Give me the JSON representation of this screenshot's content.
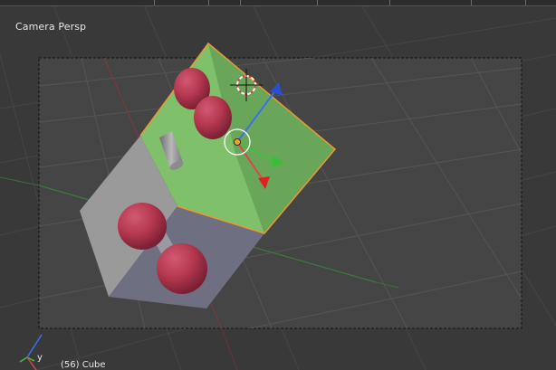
{
  "viewport": {
    "view_label": "Camera Persp",
    "object_label": "(56) Cube"
  },
  "axis_gizmo": {
    "y_label": "y",
    "x_color": "#d94646",
    "y_color": "#3ec13e",
    "z_color": "#3c6ef0"
  },
  "colors": {
    "background": "#393939",
    "camera_frame_fill": "#434343",
    "selected_face": "#7fc06a",
    "selection_outline": "#e89a33",
    "sphere": "#b4374f",
    "grid": "#4a4a4a",
    "x_axis_line": "#7a3a3a",
    "y_axis_line": "#3d7a3d"
  },
  "icons": [
    "3d-cursor-icon",
    "translate-gizmo-icon",
    "axis-orientation-icon"
  ]
}
